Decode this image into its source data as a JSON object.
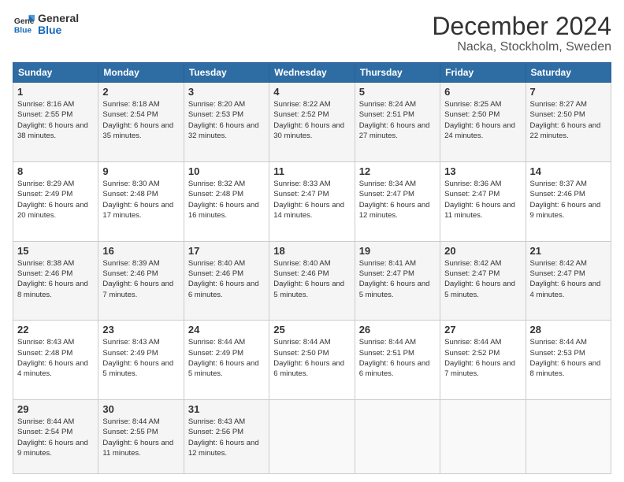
{
  "logo": {
    "line1": "General",
    "line2": "Blue"
  },
  "title": "December 2024",
  "subtitle": "Nacka, Stockholm, Sweden",
  "header_days": [
    "Sunday",
    "Monday",
    "Tuesday",
    "Wednesday",
    "Thursday",
    "Friday",
    "Saturday"
  ],
  "weeks": [
    [
      {
        "day": "1",
        "sunrise": "8:16 AM",
        "sunset": "2:55 PM",
        "daylight": "6 hours and 38 minutes."
      },
      {
        "day": "2",
        "sunrise": "8:18 AM",
        "sunset": "2:54 PM",
        "daylight": "6 hours and 35 minutes."
      },
      {
        "day": "3",
        "sunrise": "8:20 AM",
        "sunset": "2:53 PM",
        "daylight": "6 hours and 32 minutes."
      },
      {
        "day": "4",
        "sunrise": "8:22 AM",
        "sunset": "2:52 PM",
        "daylight": "6 hours and 30 minutes."
      },
      {
        "day": "5",
        "sunrise": "8:24 AM",
        "sunset": "2:51 PM",
        "daylight": "6 hours and 27 minutes."
      },
      {
        "day": "6",
        "sunrise": "8:25 AM",
        "sunset": "2:50 PM",
        "daylight": "6 hours and 24 minutes."
      },
      {
        "day": "7",
        "sunrise": "8:27 AM",
        "sunset": "2:50 PM",
        "daylight": "6 hours and 22 minutes."
      }
    ],
    [
      {
        "day": "8",
        "sunrise": "8:29 AM",
        "sunset": "2:49 PM",
        "daylight": "6 hours and 20 minutes."
      },
      {
        "day": "9",
        "sunrise": "8:30 AM",
        "sunset": "2:48 PM",
        "daylight": "6 hours and 17 minutes."
      },
      {
        "day": "10",
        "sunrise": "8:32 AM",
        "sunset": "2:48 PM",
        "daylight": "6 hours and 16 minutes."
      },
      {
        "day": "11",
        "sunrise": "8:33 AM",
        "sunset": "2:47 PM",
        "daylight": "6 hours and 14 minutes."
      },
      {
        "day": "12",
        "sunrise": "8:34 AM",
        "sunset": "2:47 PM",
        "daylight": "6 hours and 12 minutes."
      },
      {
        "day": "13",
        "sunrise": "8:36 AM",
        "sunset": "2:47 PM",
        "daylight": "6 hours and 11 minutes."
      },
      {
        "day": "14",
        "sunrise": "8:37 AM",
        "sunset": "2:46 PM",
        "daylight": "6 hours and 9 minutes."
      }
    ],
    [
      {
        "day": "15",
        "sunrise": "8:38 AM",
        "sunset": "2:46 PM",
        "daylight": "6 hours and 8 minutes."
      },
      {
        "day": "16",
        "sunrise": "8:39 AM",
        "sunset": "2:46 PM",
        "daylight": "6 hours and 7 minutes."
      },
      {
        "day": "17",
        "sunrise": "8:40 AM",
        "sunset": "2:46 PM",
        "daylight": "6 hours and 6 minutes."
      },
      {
        "day": "18",
        "sunrise": "8:40 AM",
        "sunset": "2:46 PM",
        "daylight": "6 hours and 5 minutes."
      },
      {
        "day": "19",
        "sunrise": "8:41 AM",
        "sunset": "2:47 PM",
        "daylight": "6 hours and 5 minutes."
      },
      {
        "day": "20",
        "sunrise": "8:42 AM",
        "sunset": "2:47 PM",
        "daylight": "6 hours and 5 minutes."
      },
      {
        "day": "21",
        "sunrise": "8:42 AM",
        "sunset": "2:47 PM",
        "daylight": "6 hours and 4 minutes."
      }
    ],
    [
      {
        "day": "22",
        "sunrise": "8:43 AM",
        "sunset": "2:48 PM",
        "daylight": "6 hours and 4 minutes."
      },
      {
        "day": "23",
        "sunrise": "8:43 AM",
        "sunset": "2:49 PM",
        "daylight": "6 hours and 5 minutes."
      },
      {
        "day": "24",
        "sunrise": "8:44 AM",
        "sunset": "2:49 PM",
        "daylight": "6 hours and 5 minutes."
      },
      {
        "day": "25",
        "sunrise": "8:44 AM",
        "sunset": "2:50 PM",
        "daylight": "6 hours and 6 minutes."
      },
      {
        "day": "26",
        "sunrise": "8:44 AM",
        "sunset": "2:51 PM",
        "daylight": "6 hours and 6 minutes."
      },
      {
        "day": "27",
        "sunrise": "8:44 AM",
        "sunset": "2:52 PM",
        "daylight": "6 hours and 7 minutes."
      },
      {
        "day": "28",
        "sunrise": "8:44 AM",
        "sunset": "2:53 PM",
        "daylight": "6 hours and 8 minutes."
      }
    ],
    [
      {
        "day": "29",
        "sunrise": "8:44 AM",
        "sunset": "2:54 PM",
        "daylight": "6 hours and 9 minutes."
      },
      {
        "day": "30",
        "sunrise": "8:44 AM",
        "sunset": "2:55 PM",
        "daylight": "6 hours and 11 minutes."
      },
      {
        "day": "31",
        "sunrise": "8:43 AM",
        "sunset": "2:56 PM",
        "daylight": "6 hours and 12 minutes."
      },
      null,
      null,
      null,
      null
    ]
  ]
}
